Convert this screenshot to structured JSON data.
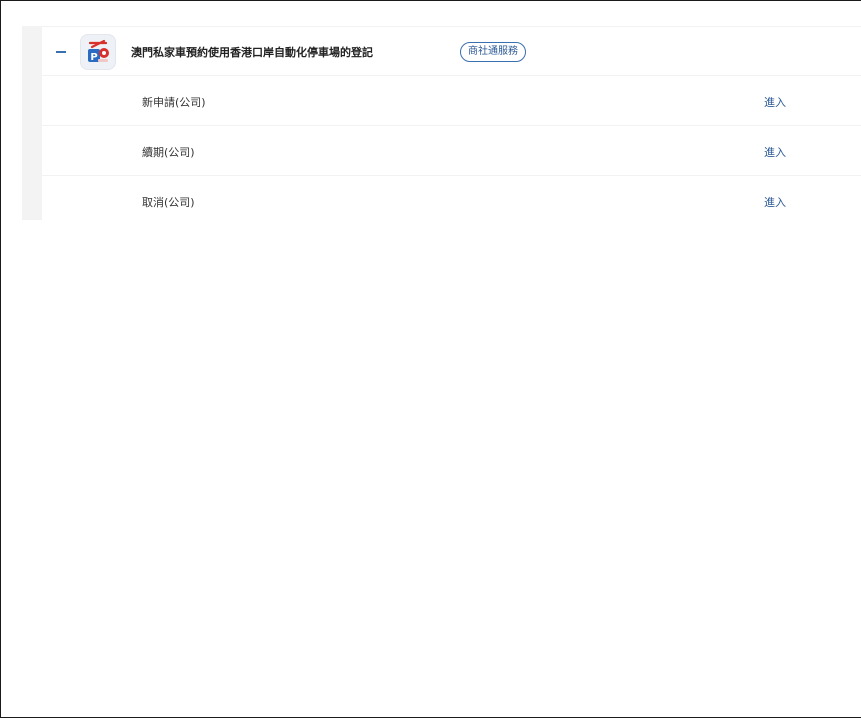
{
  "service": {
    "icon": "parking-car-icon",
    "title": "澳門私家車預約使用香港口岸自動化停車場的登記",
    "badge": "商社通服務",
    "collapse_icon": "minus-icon",
    "accent_color": "#2d5a96"
  },
  "sub_items": [
    {
      "label": "新申請(公司)",
      "action": "進入"
    },
    {
      "label": "續期(公司)",
      "action": "進入"
    },
    {
      "label": "取消(公司)",
      "action": "進入"
    }
  ]
}
